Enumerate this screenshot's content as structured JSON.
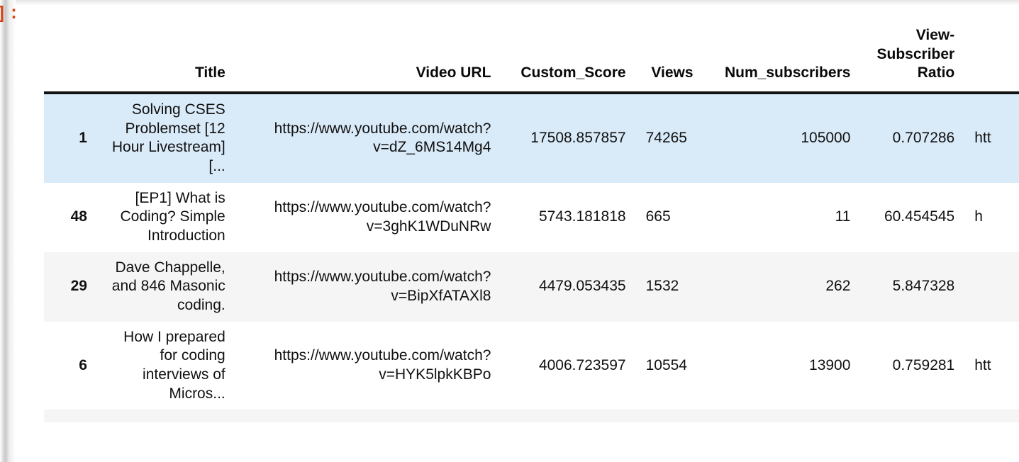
{
  "notebook": {
    "output_prompt": "]:"
  },
  "table": {
    "columns": [
      {
        "key": "index",
        "label": "",
        "align": "right"
      },
      {
        "key": "title",
        "label": "Title",
        "align": "right"
      },
      {
        "key": "url",
        "label": "Video URL",
        "align": "right"
      },
      {
        "key": "score",
        "label": "Custom_Score",
        "align": "right"
      },
      {
        "key": "views",
        "label": "Views",
        "align": "right"
      },
      {
        "key": "subs",
        "label": "Num_subscribers",
        "align": "right"
      },
      {
        "key": "ratio",
        "label": "View-Subscriber Ratio",
        "align": "right"
      },
      {
        "key": "cut",
        "label": "",
        "align": "left"
      }
    ],
    "header_labels": {
      "corner": "",
      "title": "Title",
      "url": "Video URL",
      "score": "Custom_Score",
      "views": "Views",
      "subscribers": "Num_subscribers",
      "ratio": "View-Subscriber Ratio",
      "cutoff": ""
    },
    "rows": [
      {
        "index": "1",
        "title": "Solving CSES Problemset [12 Hour Livestream] [...",
        "url": "https://www.youtube.com/watch?v=dZ_6MS14Mg4",
        "score": "17508.857857",
        "views": "74265",
        "subscribers": "105000",
        "ratio": "0.707286",
        "cutoff": "htt",
        "style": "row-highlight"
      },
      {
        "index": "48",
        "title": "[EP1] What is Coding? Simple Introduction",
        "url": "https://www.youtube.com/watch?v=3ghK1WDuNRw",
        "score": "5743.181818",
        "views": "665",
        "subscribers": "11",
        "ratio": "60.454545",
        "cutoff": "h",
        "style": "row-plain"
      },
      {
        "index": "29",
        "title": "Dave Chappelle, and 846 Masonic coding.",
        "url": "https://www.youtube.com/watch?v=BipXfATAXl8",
        "score": "4479.053435",
        "views": "1532",
        "subscribers": "262",
        "ratio": "5.847328",
        "cutoff": "",
        "style": "row-striped"
      },
      {
        "index": "6",
        "title": "How I prepared for coding interviews of Micros...",
        "url": "https://www.youtube.com/watch?v=HYK5lpkKBPo",
        "score": "4006.723597",
        "views": "10554",
        "subscribers": "13900",
        "ratio": "0.759281",
        "cutoff": "htt",
        "style": "row-plain"
      },
      {
        "index": "",
        "title": "",
        "url": "",
        "score": "",
        "views": "",
        "subscribers": "",
        "ratio": "",
        "cutoff": "",
        "style": "row-striped"
      }
    ]
  },
  "colors": {
    "row_highlight": "#d9eaf8",
    "row_striped": "#f5f5f5",
    "prompt": "#d84315",
    "text": "#111111",
    "header_rule": "#111111"
  }
}
